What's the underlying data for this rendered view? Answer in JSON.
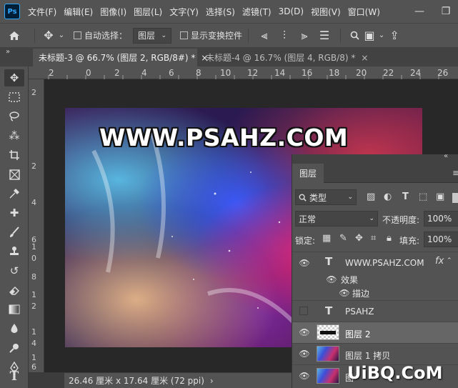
{
  "app": {
    "logo": "Ps"
  },
  "menu": [
    "文件(F)",
    "编辑(E)",
    "图像(I)",
    "图层(L)",
    "文字(Y)",
    "选择(S)",
    "滤镜(T)",
    "3D(D)",
    "视图(V)",
    "窗口(W)"
  ],
  "options": {
    "auto_select_label": "自动选择：",
    "auto_select_target": "图层",
    "show_transform_label": "显示变换控件"
  },
  "tabs": [
    {
      "label": "未标题-3 @ 66.7% (图层 2, RGB/8#) *",
      "close": "×",
      "active": true
    },
    {
      "label": "未标题-4 @ 16.7% (图层 4, RGB/8) *",
      "close": "×",
      "active": false
    }
  ],
  "ruler_top": [
    "2",
    "0",
    "2",
    "4",
    "6",
    "8",
    "10",
    "12",
    "14",
    "16",
    "18",
    "20",
    "22",
    "24",
    "26"
  ],
  "ruler_left": [
    "2",
    "2",
    "4",
    "6",
    "8",
    "1",
    "0",
    "1",
    "2",
    "1",
    "4",
    "1",
    "6"
  ],
  "canvas": {
    "text": "WWW.PSAHZ.COM"
  },
  "status": {
    "doc_size": "26.46 厘米 x 17.64 厘米 (72 ppi)",
    "arrow": "›"
  },
  "layers_panel": {
    "title": "图层",
    "filter_label": "类型",
    "blend_mode": "正常",
    "opacity_label": "不透明度:",
    "opacity_value": "100%",
    "lock_label": "锁定:",
    "fill_label": "填充:",
    "fill_value": "100%",
    "layers": [
      {
        "name": "WWW.PSAHZ.COM",
        "kind": "text",
        "visible": true,
        "fx": "fx"
      },
      {
        "name": "效果",
        "kind": "effect-group",
        "visible": true
      },
      {
        "name": "描边",
        "kind": "effect",
        "visible": true
      },
      {
        "name": "PSAHZ",
        "kind": "text",
        "visible": false
      },
      {
        "name": "图层 2",
        "kind": "pixel",
        "visible": true,
        "selected": true
      },
      {
        "name": "图层 1 拷贝",
        "kind": "pixel",
        "visible": true
      },
      {
        "name": "图",
        "kind": "pixel",
        "visible": true
      }
    ]
  },
  "watermark": "UiBQ.CoM",
  "colors": {
    "chrome": "#535353",
    "dark": "#282828",
    "tab_bar": "#424242",
    "selected_layer": "#666666"
  }
}
